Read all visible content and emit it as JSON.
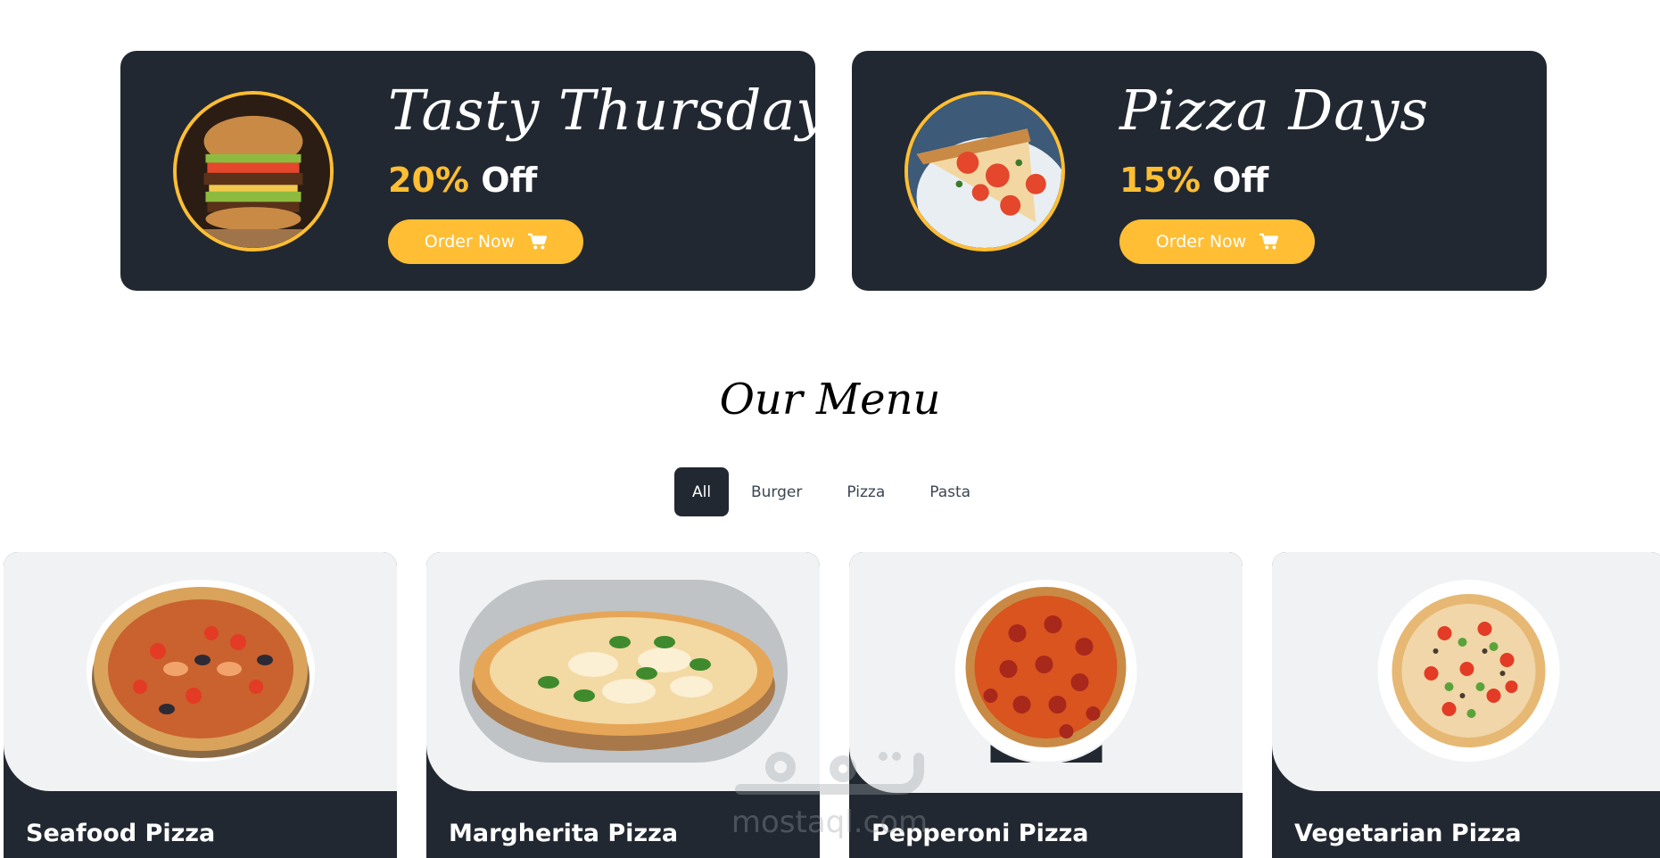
{
  "promos": [
    {
      "title": "Tasty Thursdays",
      "discount": "20%",
      "off": "Off",
      "button": "Order Now",
      "image": "burger-image"
    },
    {
      "title": "Pizza Days",
      "discount": "15%",
      "off": "Off",
      "button": "Order Now",
      "image": "pizza-slice-image"
    }
  ],
  "menu": {
    "heading": "Our Menu",
    "filters": [
      "All",
      "Burger",
      "Pizza",
      "Pasta"
    ],
    "active_filter": "All",
    "items": [
      {
        "name": "Seafood Pizza",
        "image": "seafood-pizza-image"
      },
      {
        "name": "Margherita Pizza",
        "image": "margherita-pizza-image"
      },
      {
        "name": "Pepperoni Pizza",
        "image": "pepperoni-pizza-image"
      },
      {
        "name": "Vegetarian Pizza",
        "image": "vegetarian-pizza-image"
      }
    ]
  },
  "watermark": {
    "arabic": "مستقل",
    "latin": "mostaql.com"
  },
  "colors": {
    "dark": "#222831",
    "accent": "#ffbe33",
    "card_bg": "#f1f2f3"
  }
}
